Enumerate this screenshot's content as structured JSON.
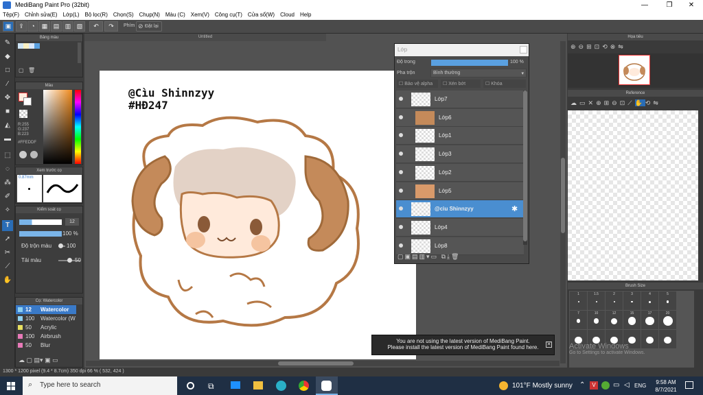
{
  "window": {
    "title": "MediBang Paint Pro (32bit)",
    "minimize": "—",
    "maximize": "❐",
    "close": "✕"
  },
  "menu": [
    "Tệp(F)",
    "Chỉnh sửa(E)",
    "Lớp(L)",
    "Bộ lọc(R)",
    "Chọn(S)",
    "Chụp(N)",
    "Màu (C)",
    "Xem(V)",
    "Công cụ(T)",
    "Cửa sổ(W)",
    "Cloud",
    "Help"
  ],
  "toolbar": {
    "shortcut_label": "Phím",
    "reset_label": "Đặt lại"
  },
  "document_tab": "Untitled",
  "panels": {
    "color_palette": "Bảng màu",
    "color": "Màu",
    "color_values": {
      "r": "R:255",
      "g": "G:237",
      "b": "B:223",
      "hex": "#FFEDDF"
    },
    "brush_preview": "Xem trước cọ",
    "brush_size_preview": "0.87mm",
    "brush_control": "Kiểm soát cọ",
    "brush_size_value": "12",
    "opacity_value": "100 %",
    "blend_label": "Độ trộn màu",
    "blend_value": "100",
    "load_label": "Tải màu",
    "load_value": "50",
    "brush_list_title": "Cọ: Watercolor",
    "brushes": [
      {
        "size": "12",
        "name": "Watercolor",
        "color": "#8fd0f0",
        "selected": true
      },
      {
        "size": "100",
        "name": "Watercolor (W",
        "color": "#8fd0f0",
        "selected": false
      },
      {
        "size": "50",
        "name": "Acrylic",
        "color": "#e8e060",
        "selected": false
      },
      {
        "size": "100",
        "name": "Airbrush",
        "color": "#e87ab8",
        "selected": false
      },
      {
        "size": "50",
        "name": "Blur",
        "color": "#e87ab8",
        "selected": false
      }
    ]
  },
  "canvas_text": {
    "line1": "@Cìu Shinnzyy",
    "line2": "#HĐ247"
  },
  "layers": {
    "title": "Lớp",
    "opacity_label": "Độ trong",
    "opacity_value": "100 %",
    "blend_label": "Pha trộn",
    "blend_value": "Bình thường",
    "protect_alpha": "Bảo vệ alpha",
    "clip": "Xén bớt",
    "lock": "Khóa",
    "items": [
      {
        "name": "Lớp7",
        "indent": false,
        "selected": false
      },
      {
        "name": "Lớp6",
        "indent": true,
        "selected": false
      },
      {
        "name": "Lớp1",
        "indent": true,
        "selected": false
      },
      {
        "name": "Lớp3",
        "indent": true,
        "selected": false
      },
      {
        "name": "Lớp2",
        "indent": true,
        "selected": false
      },
      {
        "name": "Lớp5",
        "indent": true,
        "selected": false
      },
      {
        "name": "@cìu Shinnzyy",
        "indent": false,
        "selected": true
      },
      {
        "name": "Lớp4",
        "indent": false,
        "selected": false
      },
      {
        "name": "Lớp8",
        "indent": false,
        "selected": false
      }
    ]
  },
  "right": {
    "navigator": "Họa tiêu",
    "reference": "Reference",
    "brush_size": "Brush Size",
    "sizes": [
      "1",
      "1.5",
      "2",
      "3",
      "4",
      "5",
      "7",
      "10",
      "12",
      "15",
      "17",
      "20",
      "",
      "",
      "",
      "",
      "",
      ""
    ]
  },
  "notice": {
    "line1": "You are not using the latest version of MediBang Paint.",
    "line2": "Please install the latest version of MediBang Paint found here."
  },
  "watermark": {
    "line1": "Activate Windows",
    "line2": "Go to Settings to activate Windows."
  },
  "status": "1300 * 1200 pixel   (9.4 * 8.7cm)  350 dpi  66 %  ( 532, 424 )",
  "taskbar": {
    "search": "Type here to search",
    "weather": "101°F  Mostly sunny",
    "lang": "ENG",
    "time": "9:58 AM",
    "date": "8/7/2021"
  }
}
